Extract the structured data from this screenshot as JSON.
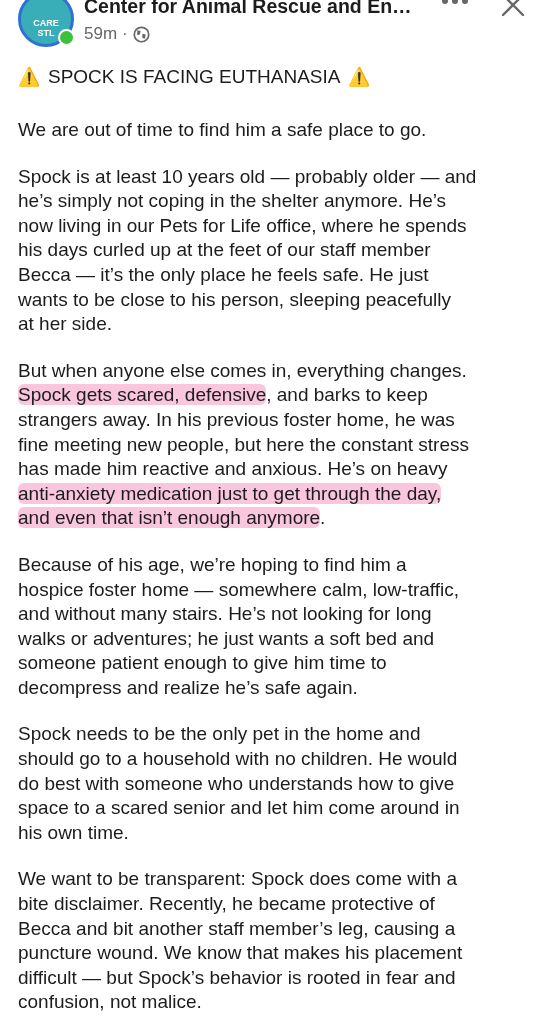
{
  "header": {
    "logo_lines": [
      "CARE",
      "STL"
    ],
    "online": true,
    "page_name": "Center for Animal Rescue and En…",
    "time": "59m",
    "separator": "·"
  },
  "title": {
    "warning_left": "⚠️",
    "text": "SPOCK IS FACING EUTHANASIA",
    "warning_right": "⚠️"
  },
  "paragraphs": [
    {
      "lines": [
        "We are out of time to find him a safe place to go."
      ]
    },
    {
      "lines": [
        "Spock is at least 10 years old — probably older — and",
        "he’s simply not coping in the shelter anymore. He’s",
        "now living in our Pets for Life office, where he spends",
        "his days curled up at the feet of our staff member",
        "Becca — it’s the only place he feels safe. He just",
        "wants to be close to his person, sleeping peacefully",
        "at her side."
      ]
    },
    {
      "lines": [
        "But when anyone else comes in, everything changes.",
        {
          "segments": [
            {
              "text": "Spock gets scared, defensive",
              "highlighted": true
            },
            {
              "text": ", and barks to keep",
              "highlighted": false
            }
          ]
        },
        "strangers away. In his previous foster home, he was",
        "fine meeting new people, but here the constant stress",
        "has made him reactive and anxious. He’s on heavy",
        {
          "segments": [
            {
              "text": "anti-anxiety medication just to get through the day,",
              "highlighted": true
            }
          ]
        },
        {
          "segments": [
            {
              "text": "and even that isn’t enough anymore",
              "highlighted": true
            },
            {
              "text": ".",
              "highlighted": false
            }
          ]
        }
      ]
    },
    {
      "lines": [
        "Because of his age, we’re hoping to find him a",
        "hospice foster home — somewhere calm, low-traffic,",
        "and without many stairs. He’s not looking for long",
        "walks or adventures; he just wants a soft bed and",
        "someone patient enough to give him time to",
        "decompress and realize he’s safe again."
      ]
    },
    {
      "lines": [
        "Spock needs to be the only pet in the home and",
        "should go to a household with no children. He would",
        "do best with someone who understands how to give",
        "space to a scared senior and let him come around in",
        "his own time."
      ]
    },
    {
      "lines": [
        "We want to be transparent: Spock does come with a",
        "bite disclaimer. Recently, he became protective of",
        "Becca and bit another staff member’s leg, causing a",
        "puncture wound. We know that makes his placement",
        "difficult — but Spock’s behavior is rooted in fear and",
        "confusion, not malice."
      ]
    }
  ]
}
